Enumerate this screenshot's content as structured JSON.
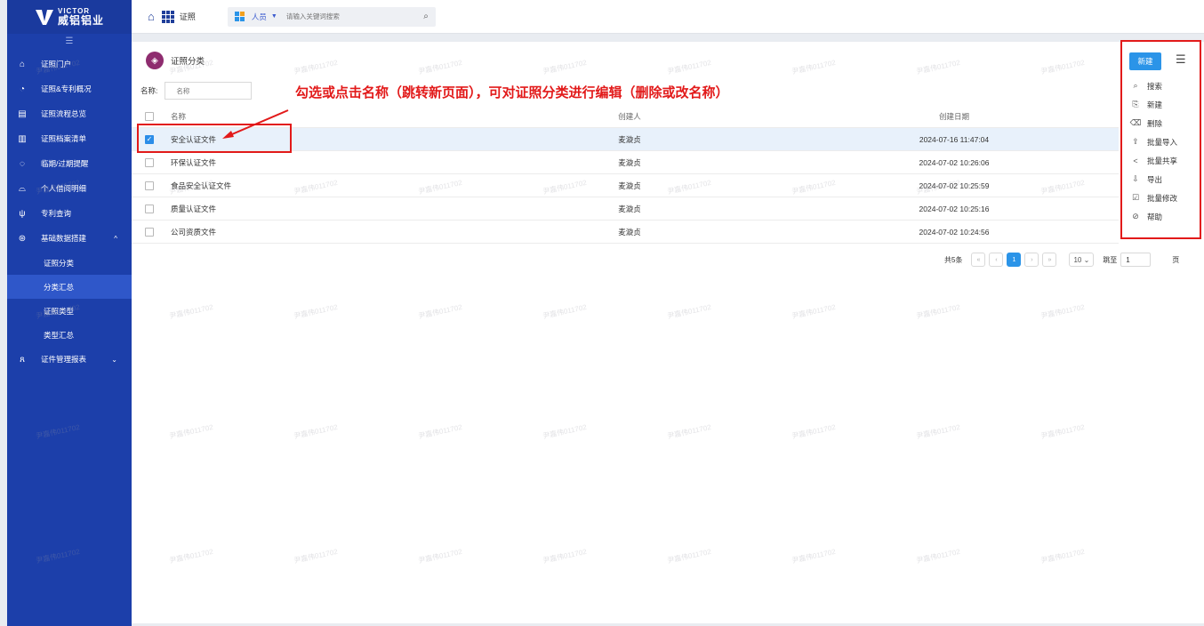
{
  "brand": {
    "en": "VICTOR",
    "cn": "威铝铝业"
  },
  "topbar": {
    "title": "证照",
    "search_scope": "人员",
    "search_placeholder": "请输入关键词搜索"
  },
  "sidebar": {
    "items": [
      {
        "label": "证照门户",
        "icon": "portal-icon"
      },
      {
        "label": "证照&专利概况",
        "icon": "overview-icon"
      },
      {
        "label": "证照流程总览",
        "icon": "process-icon"
      },
      {
        "label": "证照档案清单",
        "icon": "archive-icon"
      },
      {
        "label": "临期/过期提醒",
        "icon": "bell-icon"
      },
      {
        "label": "个人借阅明细",
        "icon": "borrow-icon"
      },
      {
        "label": "专利查询",
        "icon": "patent-icon"
      },
      {
        "label": "基础数据搭建",
        "icon": "settings-icon"
      }
    ],
    "sub_items": [
      "证照分类",
      "分类汇总",
      "证照类型",
      "类型汇总"
    ],
    "last_item": {
      "label": "证件管理报表",
      "icon": "user-icon"
    }
  },
  "page": {
    "title": "证照分类",
    "new_button": "新建",
    "filter_label": "名称:",
    "filter_placeholder": "名称"
  },
  "annotation": "勾选或点击名称（跳转新页面），可对证照分类进行编辑（删除或改名称）",
  "table": {
    "headers": {
      "name": "名称",
      "creator": "创建人",
      "date": "创建日期"
    },
    "rows": [
      {
        "name": "安全认证文件",
        "creator": "麦漩贞",
        "date": "2024-07-16 11:47:04",
        "checked": true
      },
      {
        "name": "环保认证文件",
        "creator": "麦漩贞",
        "date": "2024-07-02 10:26:06",
        "checked": false
      },
      {
        "name": "食品安全认证文件",
        "creator": "麦漩贞",
        "date": "2024-07-02 10:25:59",
        "checked": false
      },
      {
        "name": "质量认证文件",
        "creator": "麦漩贞",
        "date": "2024-07-02 10:25:16",
        "checked": false
      },
      {
        "name": "公司资质文件",
        "creator": "麦漩贞",
        "date": "2024-07-02 10:24:56",
        "checked": false
      }
    ]
  },
  "pager": {
    "total": "共5条",
    "current_page": "1",
    "page_size": "10",
    "goto_label": "跳至",
    "goto_value": "1",
    "page_unit": "页"
  },
  "action_menu": [
    {
      "label": "搜索",
      "icon": "search-icon"
    },
    {
      "label": "新建",
      "icon": "new-file-icon"
    },
    {
      "label": "删除",
      "icon": "trash-icon"
    },
    {
      "label": "批量导入",
      "icon": "upload-icon"
    },
    {
      "label": "批量共享",
      "icon": "share-icon"
    },
    {
      "label": "导出",
      "icon": "download-icon"
    },
    {
      "label": "批量修改",
      "icon": "edit-icon"
    },
    {
      "label": "帮助",
      "icon": "help-icon"
    }
  ],
  "watermark": "尹嘉伟011702",
  "colors": {
    "sidebar": "#1c3faa",
    "primary": "#2b94e8",
    "annotation": "#e21a1a"
  }
}
